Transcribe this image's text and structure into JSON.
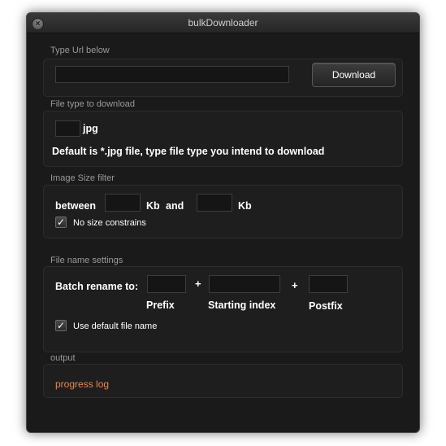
{
  "window": {
    "title": "bulkDownloader"
  },
  "url_section": {
    "label": "Type Url below",
    "url_value": "",
    "download_button": "Download"
  },
  "filetype_section": {
    "label": "File type to download",
    "extension_value": "",
    "extension_display": "jpg",
    "hint": "Default is *.jpg file, type file type you intend to download"
  },
  "size_section": {
    "label": "Image Size filter",
    "between_label": "between",
    "min_value": "",
    "unit_min": "Kb",
    "and_label": "and",
    "max_value": "",
    "unit_max": "Kb",
    "no_constraints_label": "No size constrains",
    "no_constraints_checked": true
  },
  "filename_section": {
    "label": "File name settings",
    "batch_label": "Batch rename to:",
    "prefix_value": "",
    "plus_1": "+",
    "index_value": "",
    "plus_2": "+",
    "postfix_value": "",
    "prefix_caption": "Prefix",
    "index_caption": "Starting index",
    "postfix_caption": "Postfix",
    "default_name_label": "Use default file name",
    "default_name_checked": true
  },
  "output_section": {
    "label": "output",
    "log_text": "progress log",
    "log_color": "#e8874a"
  },
  "icons": {
    "close": "close-icon",
    "check": "checkmark-icon"
  }
}
